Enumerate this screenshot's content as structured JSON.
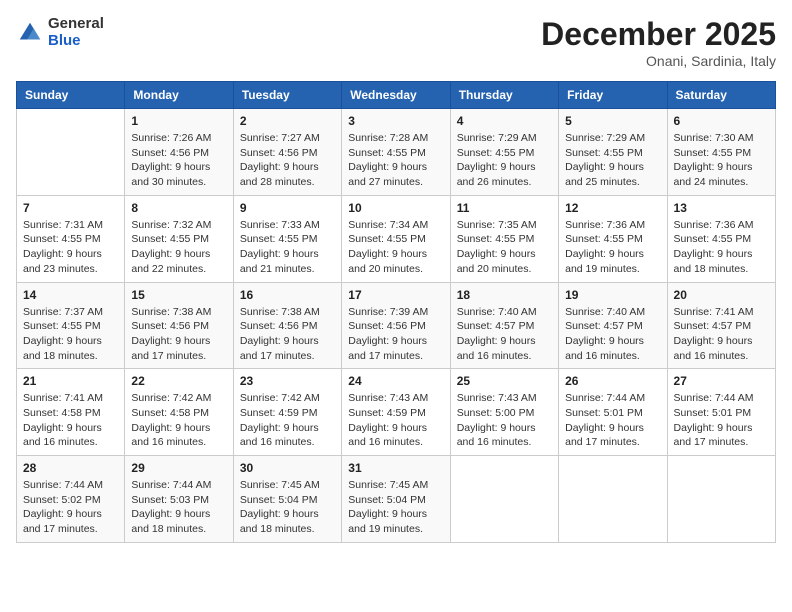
{
  "header": {
    "logo_general": "General",
    "logo_blue": "Blue",
    "title": "December 2025",
    "location": "Onani, Sardinia, Italy"
  },
  "weekdays": [
    "Sunday",
    "Monday",
    "Tuesday",
    "Wednesday",
    "Thursday",
    "Friday",
    "Saturday"
  ],
  "weeks": [
    [
      {
        "day": "",
        "info": ""
      },
      {
        "day": "1",
        "info": "Sunrise: 7:26 AM\nSunset: 4:56 PM\nDaylight: 9 hours\nand 30 minutes."
      },
      {
        "day": "2",
        "info": "Sunrise: 7:27 AM\nSunset: 4:56 PM\nDaylight: 9 hours\nand 28 minutes."
      },
      {
        "day": "3",
        "info": "Sunrise: 7:28 AM\nSunset: 4:55 PM\nDaylight: 9 hours\nand 27 minutes."
      },
      {
        "day": "4",
        "info": "Sunrise: 7:29 AM\nSunset: 4:55 PM\nDaylight: 9 hours\nand 26 minutes."
      },
      {
        "day": "5",
        "info": "Sunrise: 7:29 AM\nSunset: 4:55 PM\nDaylight: 9 hours\nand 25 minutes."
      },
      {
        "day": "6",
        "info": "Sunrise: 7:30 AM\nSunset: 4:55 PM\nDaylight: 9 hours\nand 24 minutes."
      }
    ],
    [
      {
        "day": "7",
        "info": "Sunrise: 7:31 AM\nSunset: 4:55 PM\nDaylight: 9 hours\nand 23 minutes."
      },
      {
        "day": "8",
        "info": "Sunrise: 7:32 AM\nSunset: 4:55 PM\nDaylight: 9 hours\nand 22 minutes."
      },
      {
        "day": "9",
        "info": "Sunrise: 7:33 AM\nSunset: 4:55 PM\nDaylight: 9 hours\nand 21 minutes."
      },
      {
        "day": "10",
        "info": "Sunrise: 7:34 AM\nSunset: 4:55 PM\nDaylight: 9 hours\nand 20 minutes."
      },
      {
        "day": "11",
        "info": "Sunrise: 7:35 AM\nSunset: 4:55 PM\nDaylight: 9 hours\nand 20 minutes."
      },
      {
        "day": "12",
        "info": "Sunrise: 7:36 AM\nSunset: 4:55 PM\nDaylight: 9 hours\nand 19 minutes."
      },
      {
        "day": "13",
        "info": "Sunrise: 7:36 AM\nSunset: 4:55 PM\nDaylight: 9 hours\nand 18 minutes."
      }
    ],
    [
      {
        "day": "14",
        "info": "Sunrise: 7:37 AM\nSunset: 4:55 PM\nDaylight: 9 hours\nand 18 minutes."
      },
      {
        "day": "15",
        "info": "Sunrise: 7:38 AM\nSunset: 4:56 PM\nDaylight: 9 hours\nand 17 minutes."
      },
      {
        "day": "16",
        "info": "Sunrise: 7:38 AM\nSunset: 4:56 PM\nDaylight: 9 hours\nand 17 minutes."
      },
      {
        "day": "17",
        "info": "Sunrise: 7:39 AM\nSunset: 4:56 PM\nDaylight: 9 hours\nand 17 minutes."
      },
      {
        "day": "18",
        "info": "Sunrise: 7:40 AM\nSunset: 4:57 PM\nDaylight: 9 hours\nand 16 minutes."
      },
      {
        "day": "19",
        "info": "Sunrise: 7:40 AM\nSunset: 4:57 PM\nDaylight: 9 hours\nand 16 minutes."
      },
      {
        "day": "20",
        "info": "Sunrise: 7:41 AM\nSunset: 4:57 PM\nDaylight: 9 hours\nand 16 minutes."
      }
    ],
    [
      {
        "day": "21",
        "info": "Sunrise: 7:41 AM\nSunset: 4:58 PM\nDaylight: 9 hours\nand 16 minutes."
      },
      {
        "day": "22",
        "info": "Sunrise: 7:42 AM\nSunset: 4:58 PM\nDaylight: 9 hours\nand 16 minutes."
      },
      {
        "day": "23",
        "info": "Sunrise: 7:42 AM\nSunset: 4:59 PM\nDaylight: 9 hours\nand 16 minutes."
      },
      {
        "day": "24",
        "info": "Sunrise: 7:43 AM\nSunset: 4:59 PM\nDaylight: 9 hours\nand 16 minutes."
      },
      {
        "day": "25",
        "info": "Sunrise: 7:43 AM\nSunset: 5:00 PM\nDaylight: 9 hours\nand 16 minutes."
      },
      {
        "day": "26",
        "info": "Sunrise: 7:44 AM\nSunset: 5:01 PM\nDaylight: 9 hours\nand 17 minutes."
      },
      {
        "day": "27",
        "info": "Sunrise: 7:44 AM\nSunset: 5:01 PM\nDaylight: 9 hours\nand 17 minutes."
      }
    ],
    [
      {
        "day": "28",
        "info": "Sunrise: 7:44 AM\nSunset: 5:02 PM\nDaylight: 9 hours\nand 17 minutes."
      },
      {
        "day": "29",
        "info": "Sunrise: 7:44 AM\nSunset: 5:03 PM\nDaylight: 9 hours\nand 18 minutes."
      },
      {
        "day": "30",
        "info": "Sunrise: 7:45 AM\nSunset: 5:04 PM\nDaylight: 9 hours\nand 18 minutes."
      },
      {
        "day": "31",
        "info": "Sunrise: 7:45 AM\nSunset: 5:04 PM\nDaylight: 9 hours\nand 19 minutes."
      },
      {
        "day": "",
        "info": ""
      },
      {
        "day": "",
        "info": ""
      },
      {
        "day": "",
        "info": ""
      }
    ]
  ]
}
